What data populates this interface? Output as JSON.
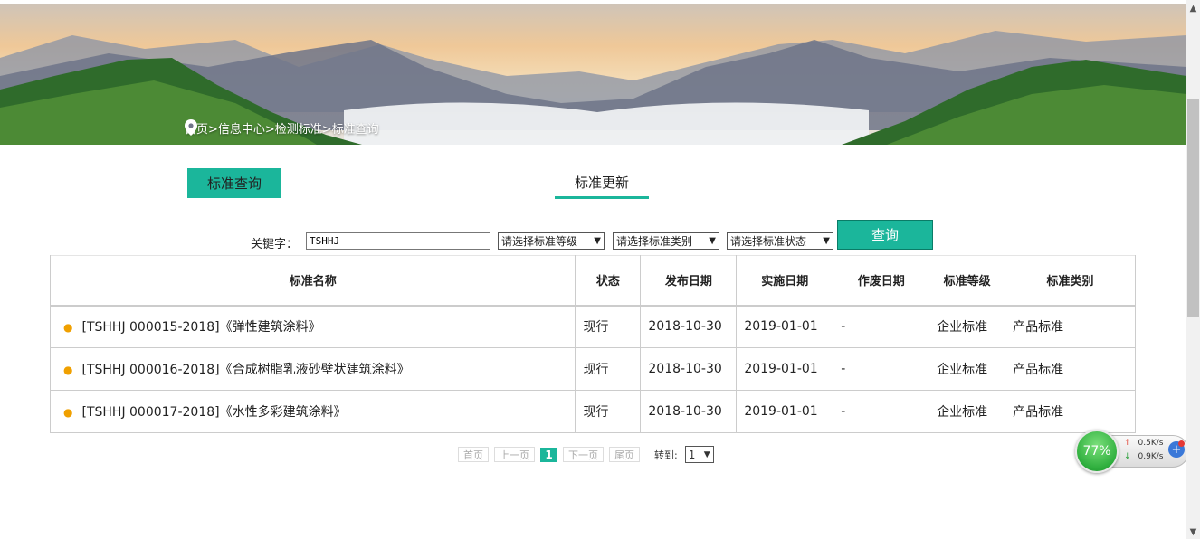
{
  "breadcrumb": "首页>信息中心>检测标准>标准查询",
  "tabs": [
    {
      "label": "标准查询"
    },
    {
      "label": "标准更新"
    }
  ],
  "search": {
    "keyword_label": "关键字：",
    "keyword_value": "TSHHJ",
    "select_level": "请选择标准等级",
    "select_category": "请选择标准类别",
    "select_status": "请选择标准状态",
    "button_label": "查询"
  },
  "table": {
    "headers": [
      "标准名称",
      "状态",
      "发布日期",
      "实施日期",
      "作废日期",
      "标准等级",
      "标准类别"
    ],
    "rows": [
      [
        "[TSHHJ 000015-2018]《弹性建筑涂料》",
        "现行",
        "2018-10-30",
        "2019-01-01",
        "-",
        "企业标准",
        "产品标准"
      ],
      [
        "[TSHHJ 000016-2018]《合成树脂乳液砂壁状建筑涂料》",
        "现行",
        "2018-10-30",
        "2019-01-01",
        "-",
        "企业标准",
        "产品标准"
      ],
      [
        "[TSHHJ 000017-2018]《水性多彩建筑涂料》",
        "现行",
        "2018-10-30",
        "2019-01-01",
        "-",
        "企业标准",
        "产品标准"
      ]
    ]
  },
  "pagination": {
    "first": "首页",
    "prev": "上一页",
    "current": "1",
    "next": "下一页",
    "last": "尾页",
    "jump_label": "转到:",
    "jump_value": "1"
  },
  "net_widget": {
    "percent": "77%",
    "up_speed": "0.5K/s",
    "down_speed": "0.9K/s"
  },
  "colors": {
    "accent": "#1bb69b",
    "bullet": "#f0a000"
  }
}
